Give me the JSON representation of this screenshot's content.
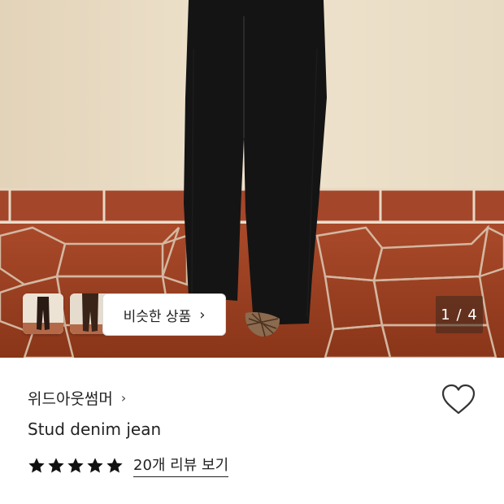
{
  "gallery": {
    "similar_label": "비슷한 상품",
    "similar_chevron": "›",
    "counter": "1 / 4",
    "thumbnails": [
      {
        "name": "thumbnail-1"
      },
      {
        "name": "thumbnail-2"
      }
    ]
  },
  "product": {
    "brand": "위드아웃썸머",
    "brand_chevron": "›",
    "name": "Stud denim jean",
    "rating_stars": 5,
    "review_link": "20개 리뷰 보기",
    "favorite_icon": "heart-outline-icon"
  },
  "colors": {
    "wall": "#e9dcc6",
    "tile": "#9b3f22",
    "jeans": "#141414"
  }
}
